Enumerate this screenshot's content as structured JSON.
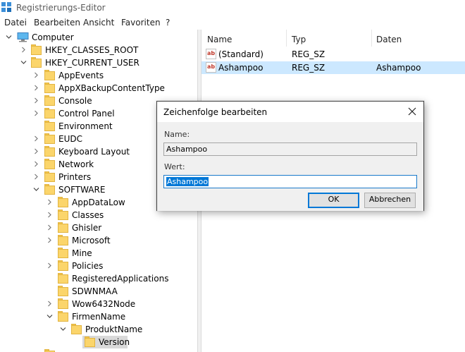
{
  "window": {
    "title": "Registrierungs-Editor"
  },
  "menu": [
    "Datei",
    "Bearbeiten",
    "Ansicht",
    "Favoriten",
    "?"
  ],
  "tree": {
    "root": "Computer",
    "hives": [
      "HKEY_CLASSES_ROOT",
      "HKEY_CURRENT_USER"
    ],
    "hkcu_children": [
      "AppEvents",
      "AppXBackupContentType",
      "Console",
      "Control Panel",
      "Environment",
      "EUDC",
      "Keyboard Layout",
      "Network",
      "Printers",
      "SOFTWARE"
    ],
    "software_children": [
      "AppDataLow",
      "Classes",
      "Ghisler",
      "Microsoft",
      "Mine",
      "Policies",
      "RegisteredApplications",
      "SDWNMAA",
      "Wow6432Node",
      "FirmenName"
    ],
    "firmenname_children": [
      "ProduktName"
    ],
    "produktname_children": [
      "Version"
    ]
  },
  "list": {
    "columns": [
      "Name",
      "Typ",
      "Daten"
    ],
    "rows": [
      {
        "name": "(Standard)",
        "type": "REG_SZ",
        "data": ""
      },
      {
        "name": "Ashampoo",
        "type": "REG_SZ",
        "data": "Ashampoo"
      }
    ]
  },
  "dialog": {
    "title": "Zeichenfolge bearbeiten",
    "name_label": "Name:",
    "name_value": "Ashampoo",
    "value_label": "Wert:",
    "value_value": "Ashampoo",
    "ok_label": "OK",
    "cancel_label": "Abbrechen"
  },
  "colors": {
    "accent": "#0078d7",
    "selection_light": "#cce8ff",
    "folder": "#fbd56b"
  }
}
